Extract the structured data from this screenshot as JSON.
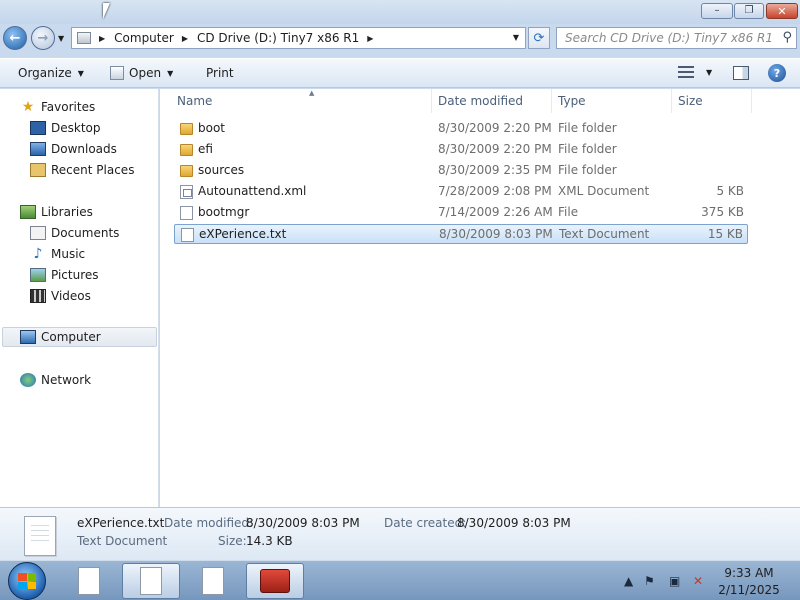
{
  "window": {
    "controls": {
      "minimize": "–",
      "maximize": "❐",
      "close": "✕"
    }
  },
  "address": {
    "crumbs": [
      "Computer",
      "CD Drive (D:) Tiny7 x86 R1"
    ]
  },
  "search": {
    "placeholder": "Search CD Drive (D:) Tiny7 x86 R1"
  },
  "toolbar": {
    "organize": "Organize",
    "open": "Open",
    "print": "Print"
  },
  "nav": {
    "favorites": "Favorites",
    "desktop": "Desktop",
    "downloads": "Downloads",
    "recent_places": "Recent Places",
    "libraries": "Libraries",
    "documents": "Documents",
    "music": "Music",
    "pictures": "Pictures",
    "videos": "Videos",
    "computer": "Computer",
    "network": "Network"
  },
  "columns": {
    "name": "Name",
    "date": "Date modified",
    "type": "Type",
    "size": "Size"
  },
  "files": [
    {
      "name": "boot",
      "date": "8/30/2009 2:20 PM",
      "type": "File folder",
      "size": "",
      "icon": "folder-icon"
    },
    {
      "name": "efi",
      "date": "8/30/2009 2:20 PM",
      "type": "File folder",
      "size": "",
      "icon": "folder-icon"
    },
    {
      "name": "sources",
      "date": "8/30/2009 2:35 PM",
      "type": "File folder",
      "size": "",
      "icon": "folder-icon"
    },
    {
      "name": "Autounattend.xml",
      "date": "7/28/2009 2:08 PM",
      "type": "XML Document",
      "size": "5 KB",
      "icon": "xml-file-icon"
    },
    {
      "name": "bootmgr",
      "date": "7/14/2009 2:26 AM",
      "type": "File",
      "size": "375 KB",
      "icon": "file-icon"
    },
    {
      "name": "eXPerience.txt",
      "date": "8/30/2009 8:03 PM",
      "type": "Text Document",
      "size": "15 KB",
      "icon": "text-file-icon",
      "selected": true
    }
  ],
  "details": {
    "name": "eXPerience.txt",
    "type": "Text Document",
    "modified_label": "Date modified:",
    "modified_value": "8/30/2009 8:03 PM",
    "created_label": "Date created:",
    "created_value": "8/30/2009 8:03 PM",
    "size_label": "Size:",
    "size_value": "14.3 KB"
  },
  "taskbar": {
    "time": "9:33 AM",
    "date": "2/11/2025"
  }
}
